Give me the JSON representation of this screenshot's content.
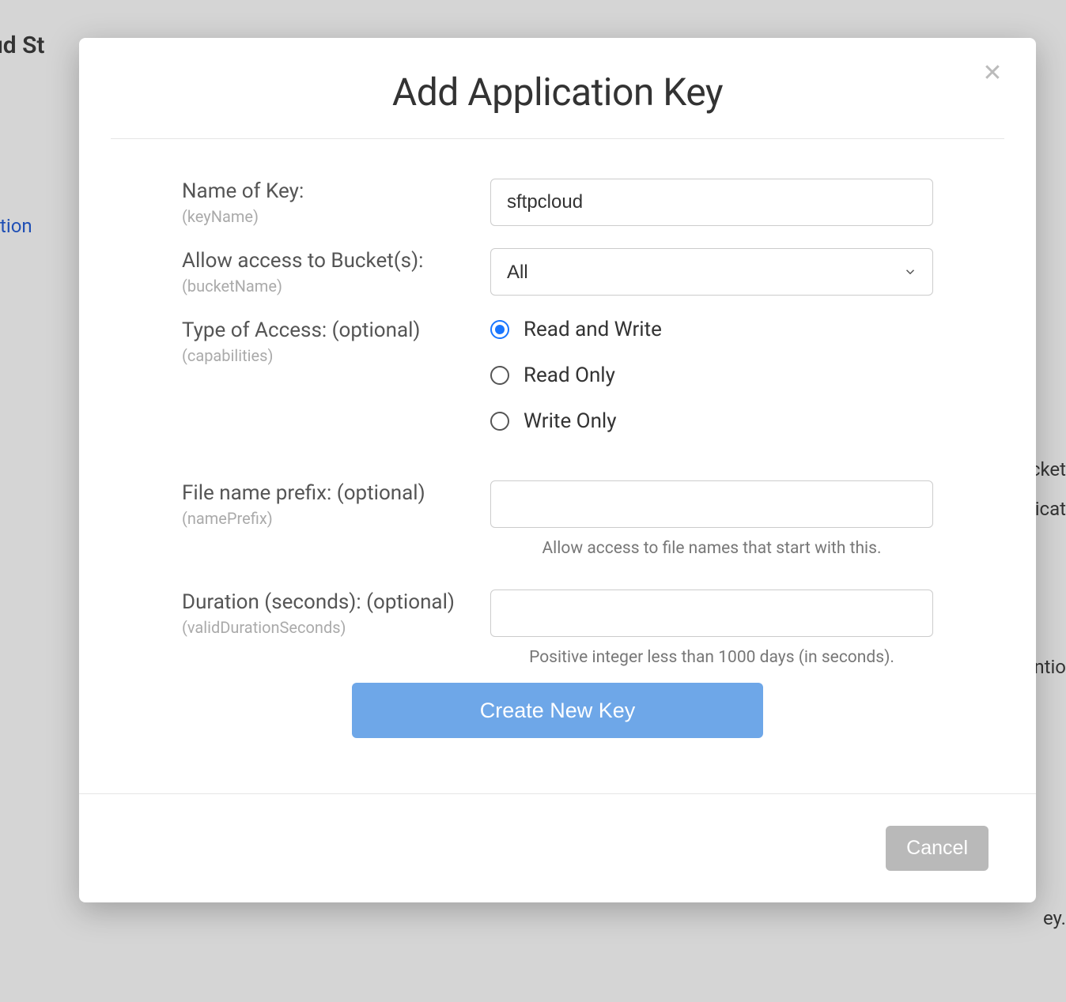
{
  "background": {
    "text1": "oud St",
    "text2": "tion",
    "text3": "ucket",
    "text4": "eplicat",
    "text5": "entio",
    "text6": "ey."
  },
  "modal": {
    "title": "Add Application Key",
    "close_symbol": "✕",
    "fields": {
      "name": {
        "label": "Name of Key:",
        "sub": "(keyName)",
        "value": "sftpcloud"
      },
      "bucket": {
        "label": "Allow access to Bucket(s):",
        "sub": "(bucketName)",
        "selected": "All"
      },
      "access": {
        "label": "Type of Access: (optional)",
        "sub": "(capabilities)",
        "options": {
          "rw": "Read and Write",
          "ro": "Read Only",
          "wo": "Write Only"
        },
        "selected": "rw"
      },
      "prefix": {
        "label": "File name prefix: (optional)",
        "sub": "(namePrefix)",
        "value": "",
        "help": "Allow access to file names that start with this."
      },
      "duration": {
        "label": "Duration (seconds): (optional)",
        "sub": "(validDurationSeconds)",
        "value": "",
        "help": "Positive integer less than 1000 days (in seconds)."
      }
    },
    "actions": {
      "create": "Create New Key",
      "cancel": "Cancel"
    }
  }
}
